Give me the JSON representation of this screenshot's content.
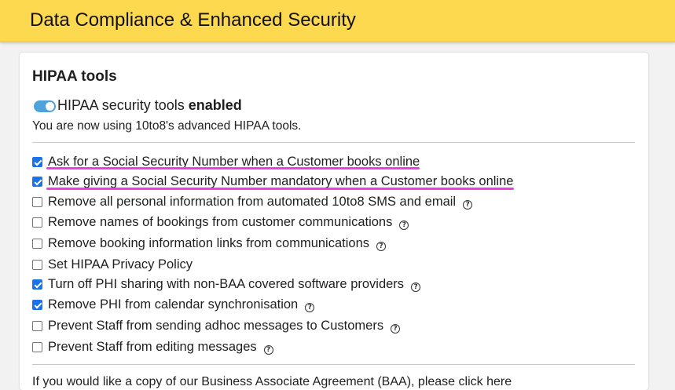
{
  "header": {
    "title": "Data Compliance & Enhanced Security"
  },
  "hipaa": {
    "title": "HIPAA tools",
    "toggle": {
      "label": "HIPAA security tools",
      "state_text": "enabled",
      "on": true
    },
    "status_text": "You are now using 10to8's advanced HIPAA tools.",
    "options": [
      {
        "label": "Ask for a Social Security Number when a Customer books online",
        "checked": true,
        "help": false
      },
      {
        "label": "Make giving a Social Security Number mandatory when a Customer books online",
        "checked": true,
        "help": false
      },
      {
        "label": "Remove all personal information from automated 10to8 SMS and email",
        "checked": false,
        "help": true
      },
      {
        "label": "Remove names of bookings from customer communications",
        "checked": false,
        "help": true
      },
      {
        "label": "Remove booking information links from communications",
        "checked": false,
        "help": true
      },
      {
        "label": "Set HIPAA Privacy Policy",
        "checked": false,
        "help": false
      },
      {
        "label": "Turn off PHI sharing with non-BAA covered software providers",
        "checked": true,
        "help": true
      },
      {
        "label": "Remove PHI from calendar synchronisation",
        "checked": true,
        "help": true
      },
      {
        "label": "Prevent Staff from sending adhoc messages to Customers",
        "checked": false,
        "help": true
      },
      {
        "label": "Prevent Staff from editing messages",
        "checked": false,
        "help": true
      }
    ],
    "footer_text": "If you would like a copy of our Business Associate Agreement (BAA), please click here"
  },
  "colors": {
    "header_bg": "#fcd94e",
    "accent": "#1a73e8",
    "toggle": "#4da3db",
    "annotation": "#f03ce8"
  },
  "icons": {
    "help": "question-circle-icon"
  }
}
